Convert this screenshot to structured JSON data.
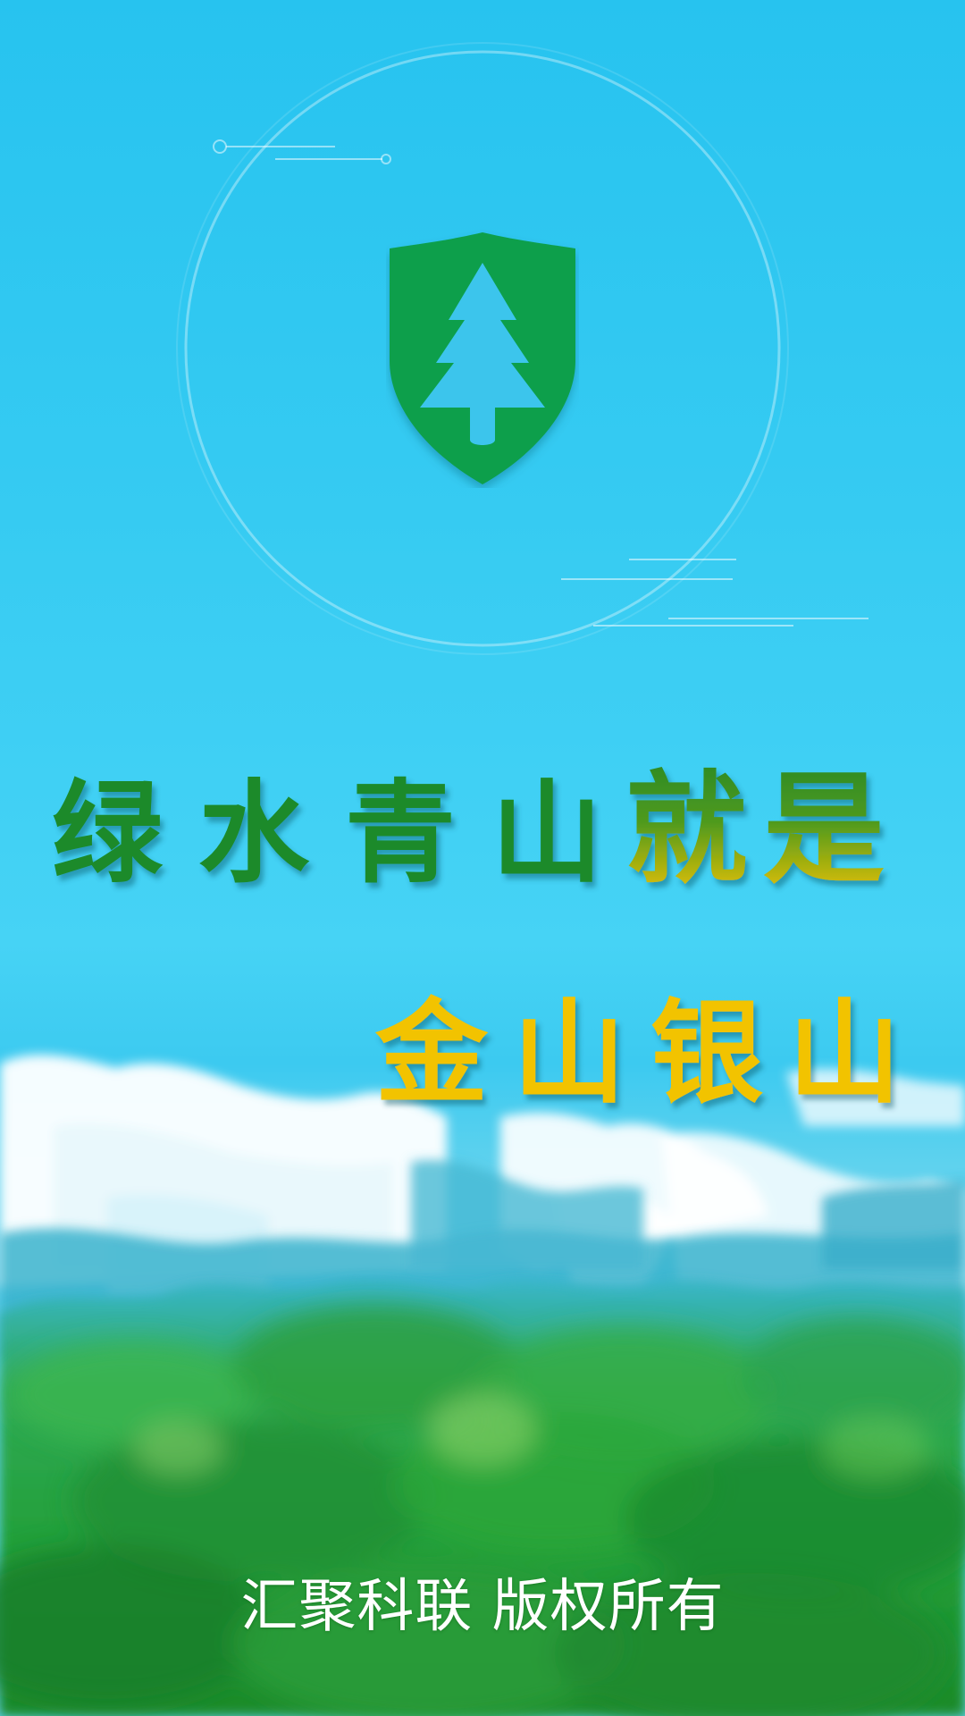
{
  "splash": {
    "logo_icon": "pine-tree-shield-icon",
    "slogan": {
      "line1": {
        "green_part": "绿水青山",
        "gradient_part": "就是"
      },
      "line2": "金山银山"
    },
    "copyright": "汇聚科联 版权所有"
  },
  "colors": {
    "sky_top": "#27c3ef",
    "sky_mid": "#46d3f5",
    "brand_green": "#0f9f4c",
    "slogan_green": "#1a8a2a",
    "slogan_gold": "#f2c300",
    "cloud_white": "#ffffff",
    "forest_green": "#2aa63a"
  }
}
